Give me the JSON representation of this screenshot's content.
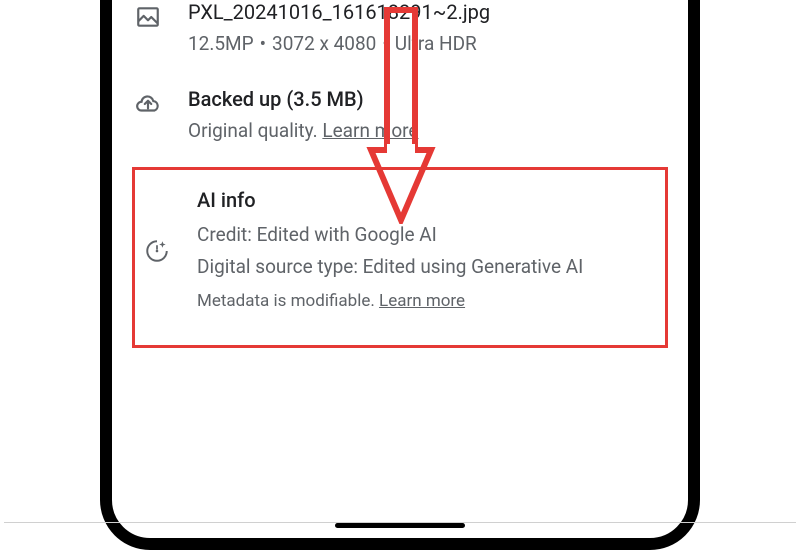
{
  "file": {
    "name": "PXL_20241016_161618291~2.jpg",
    "megapixels": "12.5MP",
    "dimensions": "3072 x 4080",
    "hdr": "Ultra HDR"
  },
  "backup": {
    "title": "Backed up (3.5 MB)",
    "quality": "Original quality.",
    "learn_more": "Learn more"
  },
  "ai_info": {
    "title": "AI info",
    "credit": "Credit: Edited with Google AI",
    "source_type": "Digital source type: Edited using Generative AI",
    "meta_note": "Metadata is modifiable.",
    "learn_more": "Learn more"
  },
  "annotation": {
    "highlight_color": "#e53935"
  }
}
